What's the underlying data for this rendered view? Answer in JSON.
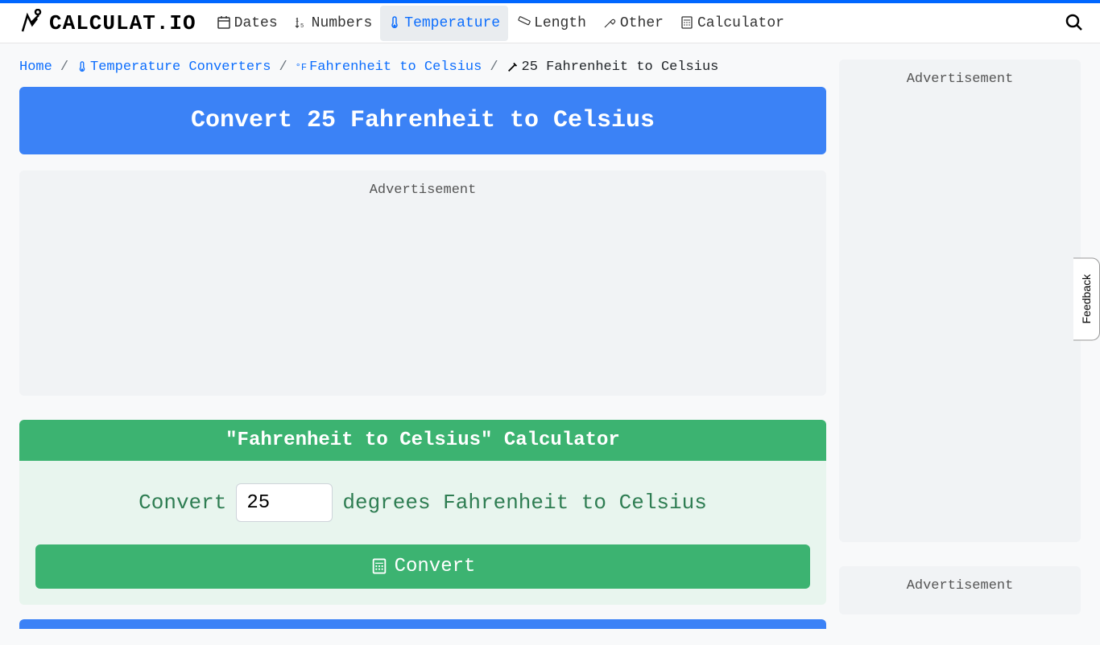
{
  "logo": "CALCULAT.IO",
  "nav": {
    "dates": "Dates",
    "numbers": "Numbers",
    "temperature": "Temperature",
    "length": "Length",
    "other": "Other",
    "calculator": "Calculator"
  },
  "breadcrumb": {
    "home": "Home",
    "temp": "Temperature Converters",
    "f2c": "Fahrenheit to Celsius",
    "current": "25 Fahrenheit to Celsius"
  },
  "page_title": "Convert 25 Fahrenheit to Celsius",
  "ad_label": "Advertisement",
  "calculator": {
    "title": "\"Fahrenheit to Celsius\" Calculator",
    "prefix": "Convert",
    "value": "25",
    "suffix": "degrees Fahrenheit to Celsius",
    "button": "Convert"
  },
  "feedback": "Feedback"
}
